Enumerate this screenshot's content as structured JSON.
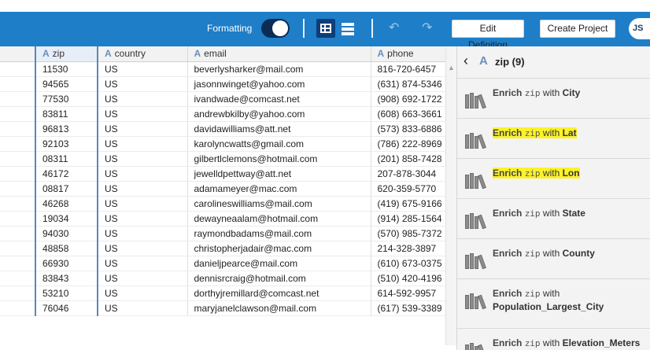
{
  "toolbar": {
    "formatting_label": "Formatting",
    "edit_definition_label": "Edit Definition",
    "create_project_label": "Create Project",
    "avatar_initials": "JS",
    "accent_color": "#1e7ec8",
    "icons": [
      "toggle",
      "grid-view-icon",
      "list-view-icon",
      "undo-icon",
      "redo-icon"
    ]
  },
  "table": {
    "columns": [
      {
        "icon": "A",
        "label": "zip"
      },
      {
        "icon": "A",
        "label": "country"
      },
      {
        "icon": "A",
        "label": "email"
      },
      {
        "icon": "A",
        "label": "phone"
      }
    ],
    "rows": [
      {
        "zip": "11530",
        "country": "US",
        "email": "beverlysharker@mail.com",
        "phone": "816-720-6457"
      },
      {
        "zip": "94565",
        "country": "US",
        "email": "jasonnwinget@yahoo.com",
        "phone": "(631) 874-5346"
      },
      {
        "zip": "77530",
        "country": "US",
        "email": "ivandwade@comcast.net",
        "phone": "(908) 692-1722"
      },
      {
        "zip": "83811",
        "country": "US",
        "email": "andrewbkilby@yahoo.com",
        "phone": "(608) 663-3661"
      },
      {
        "zip": "96813",
        "country": "US",
        "email": "davidawilliams@att.net",
        "phone": "(573) 833-6886"
      },
      {
        "zip": "92103",
        "country": "US",
        "email": "karolyncwatts@gmail.com",
        "phone": "(786) 222-8969"
      },
      {
        "zip": "08311",
        "country": "US",
        "email": "gilbertlclemons@hotmail.com",
        "phone": "(201) 858-7428"
      },
      {
        "zip": "46172",
        "country": "US",
        "email": "jewelldpettway@att.net",
        "phone": "207-878-3044"
      },
      {
        "zip": "08817",
        "country": "US",
        "email": "adamameyer@mac.com",
        "phone": "620-359-5770"
      },
      {
        "zip": "46268",
        "country": "US",
        "email": "carolineswilliams@mail.com",
        "phone": "(419) 675-9166"
      },
      {
        "zip": "19034",
        "country": "US",
        "email": "dewayneaalam@hotmail.com",
        "phone": "(914) 285-1564"
      },
      {
        "zip": "94030",
        "country": "US",
        "email": "raymondbadams@mail.com",
        "phone": "(570) 985-7372"
      },
      {
        "zip": "48858",
        "country": "US",
        "email": "christopherjadair@mac.com",
        "phone": "214-328-3897"
      },
      {
        "zip": "66930",
        "country": "US",
        "email": "danieljpearce@mail.com",
        "phone": "(610) 673-0375"
      },
      {
        "zip": "83843",
        "country": "US",
        "email": "dennisrcraig@hotmail.com",
        "phone": "(510) 420-4196"
      },
      {
        "zip": "53210",
        "country": "US",
        "email": "dorthyjremillard@comcast.net",
        "phone": "614-592-9957"
      },
      {
        "zip": "76046",
        "country": "US",
        "email": "maryjanelclawson@mail.com",
        "phone": "(617) 539-3389"
      }
    ]
  },
  "panel": {
    "back_icon": "chevron-left-icon",
    "column_icon": "A",
    "title": "zip (9)",
    "cards": [
      {
        "prefix": "Enrich",
        "column": "zip",
        "mid": "with",
        "target": "City",
        "highlighted": false
      },
      {
        "prefix": "Enrich",
        "column": "zip",
        "mid": "with",
        "target": "Lat",
        "highlighted": true
      },
      {
        "prefix": "Enrich",
        "column": "zip",
        "mid": "with",
        "target": "Lon",
        "highlighted": true
      },
      {
        "prefix": "Enrich",
        "column": "zip",
        "mid": "with",
        "target": "State",
        "highlighted": false
      },
      {
        "prefix": "Enrich",
        "column": "zip",
        "mid": "with",
        "target": "County",
        "highlighted": false
      },
      {
        "prefix": "Enrich",
        "column": "zip",
        "mid": "with",
        "target": "Population_Largest_City",
        "highlighted": false
      },
      {
        "prefix": "Enrich",
        "column": "zip",
        "mid": "with",
        "target": "Elevation_Meters",
        "highlighted": false
      }
    ],
    "highlight_color": "#fbf22b"
  }
}
